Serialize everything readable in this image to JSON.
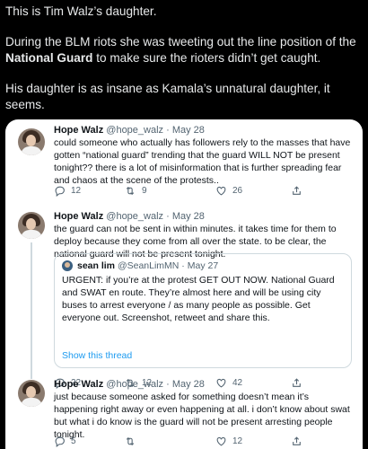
{
  "post": {
    "line1": "This is Tim Walz’s daughter.",
    "line2_pre": "During the BLM riots she was tweeting out the line position of the ",
    "line2_bold": "National Guard",
    "line2_post": " to make sure the rioters didn’t get caught.",
    "line3": "His daughter is as insane as Kamala’s unnatural daughter, it seems."
  },
  "tweets": [
    {
      "name": "Hope Walz",
      "handle": "@hope_walz",
      "date": "May 28",
      "text": "could someone who actually has followers rely to the masses that have gotten “national guard” trending that the guard WILL NOT be present tonight?? there is a lot of misinformation that is further spreading fear and chaos at the scene of the protests..",
      "replies": "12",
      "retweets": "9",
      "likes": "26"
    },
    {
      "name": "Hope Walz",
      "handle": "@hope_walz",
      "date": "May 28",
      "text": "the guard can not be sent in within minutes. it takes time for them to deploy because they come from all over the state. to be clear, the national guard will not be present tonight.",
      "replies": "22",
      "retweets": "12",
      "likes": "42",
      "quote": {
        "name": "sean lim",
        "handle": "@SeanLimMN",
        "date": "May 27",
        "text": "URGENT: if you’re at the protest GET OUT NOW. National Guard and SWAT en route. They’re almost here and will be using city buses to arrest everyone / as many people as possible. Get everyone out. Screenshot, retweet and share this.",
        "link": "Show this thread"
      }
    },
    {
      "name": "Hope Walz",
      "handle": "@hope_walz",
      "date": "May 28",
      "text": "just because someone asked for something doesn’t mean it’s happening right away or even happening at all. i don’t know about swat but what i do know is the guard will not be present arresting people tonight.",
      "replies": "5",
      "retweets": "",
      "likes": "12"
    }
  ],
  "separator": " · ",
  "icons": [
    "reply-icon",
    "retweet-icon",
    "like-icon",
    "share-icon"
  ],
  "colors": {
    "link": "#1d9bf0",
    "meta": "#536471",
    "border": "#cfd9de"
  }
}
